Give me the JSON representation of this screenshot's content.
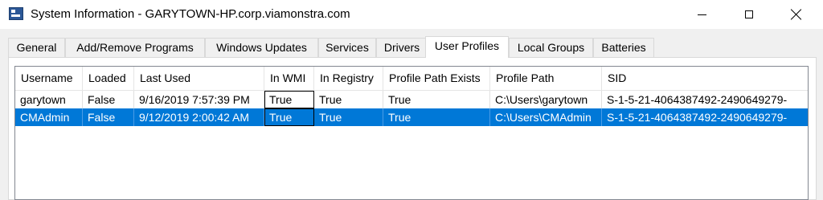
{
  "window": {
    "title": "System Information - GARYTOWN-HP.corp.viamonstra.com",
    "icon": "system-info-icon"
  },
  "tabs": [
    {
      "label": "General",
      "active": false
    },
    {
      "label": "Add/Remove Programs",
      "active": false
    },
    {
      "label": "Windows Updates",
      "active": false
    },
    {
      "label": "Services",
      "active": false
    },
    {
      "label": "Drivers",
      "active": false
    },
    {
      "label": "User Profiles",
      "active": true
    },
    {
      "label": "Local Groups",
      "active": false
    },
    {
      "label": "Batteries",
      "active": false
    }
  ],
  "table": {
    "columns": [
      "Username",
      "Loaded",
      "Last Used",
      "In WMI",
      "In Registry",
      "Profile Path Exists",
      "Profile Path",
      "SID"
    ],
    "rows": [
      {
        "selected": false,
        "cells": [
          "garytown",
          "False",
          "9/16/2019 7:57:39 PM",
          "True",
          "True",
          "True",
          "C:\\Users\\garytown",
          "S-1-5-21-4064387492-2490649279-"
        ]
      },
      {
        "selected": true,
        "cells": [
          "CMAdmin",
          "False",
          "9/12/2019 2:00:42 AM",
          "True",
          "True",
          "True",
          "C:\\Users\\CMAdmin",
          "S-1-5-21-4064387492-2490649279-"
        ]
      }
    ]
  },
  "colors": {
    "selection": "#0078d7",
    "window_bg": "#f0f0f0"
  }
}
